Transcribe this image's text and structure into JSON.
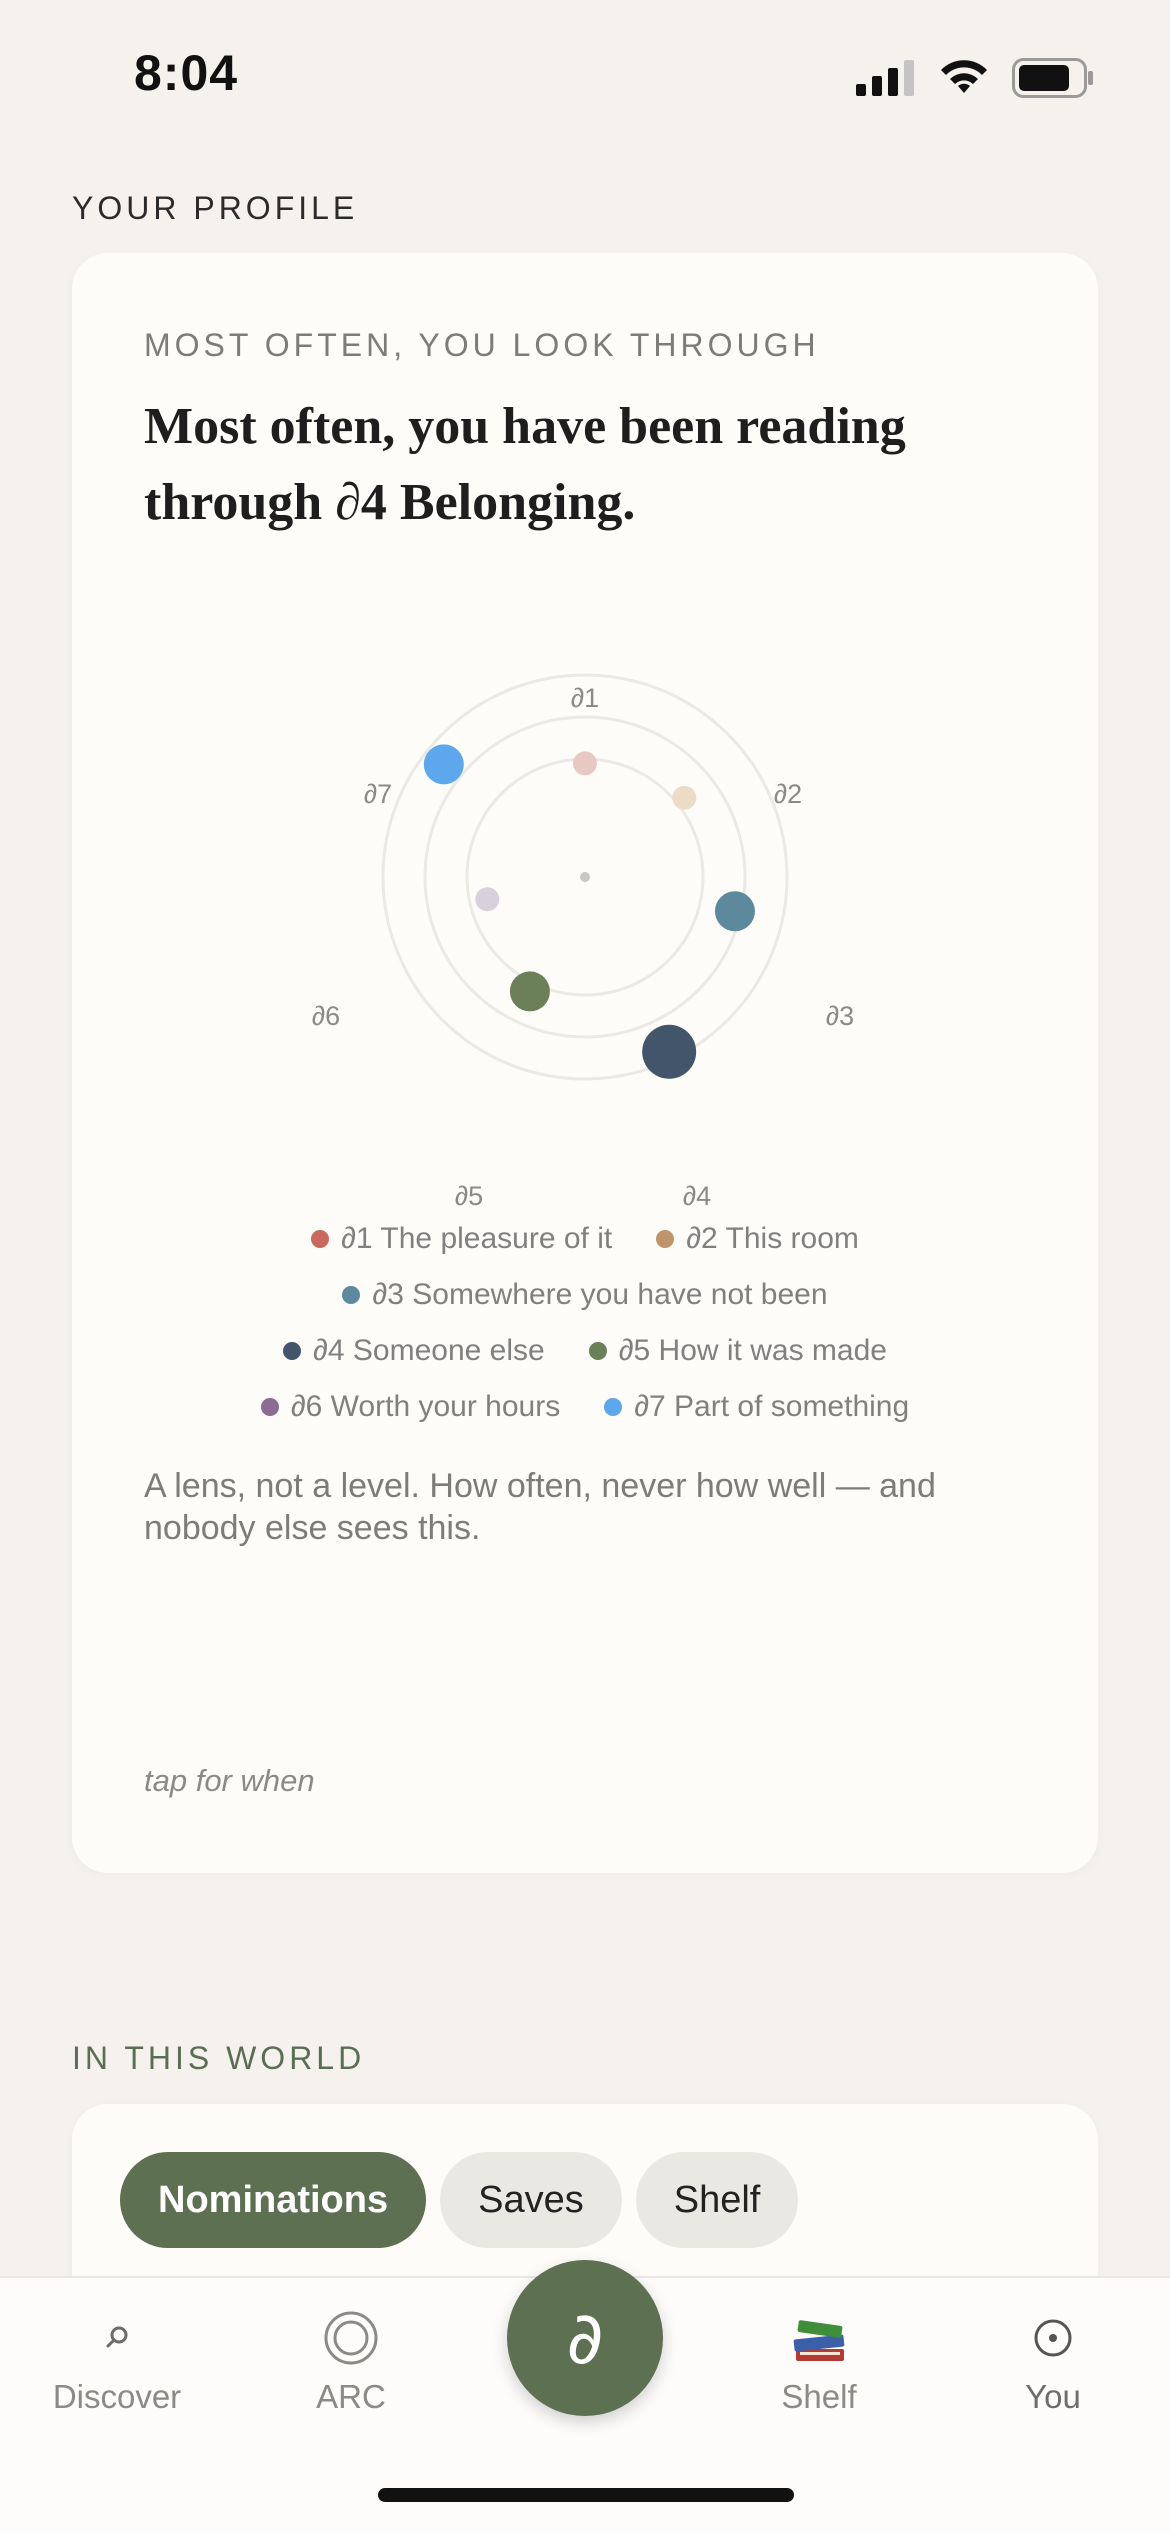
{
  "status_bar": {
    "time": "8:04"
  },
  "profile": {
    "section_label": "YOUR PROFILE",
    "kicker": "MOST OFTEN, YOU LOOK THROUGH",
    "headline": "Most often, you have been reading through ∂4 Belonging.",
    "radar": {
      "axis_labels": [
        "∂1",
        "∂2",
        "∂3",
        "∂4",
        "∂5",
        "∂6",
        "∂7"
      ],
      "points": [
        {
          "lens": "∂1",
          "color": "#e8c9c2",
          "level": 0.4,
          "size": "small"
        },
        {
          "lens": "∂2",
          "color": "#ecdcc6",
          "level": 0.5,
          "size": "small"
        },
        {
          "lens": "∂3",
          "color": "#5c8a9c",
          "level": 0.7,
          "size": "medium"
        },
        {
          "lens": "∂4",
          "color": "#42556b",
          "level": 1.0,
          "size": "large"
        },
        {
          "lens": "∂5",
          "color": "#6b7f58",
          "level": 0.5,
          "size": "medium"
        },
        {
          "lens": "∂6",
          "color": "#d8d0dc",
          "level": 0.3,
          "size": "small"
        },
        {
          "lens": "∂7",
          "color": "#5da8ec",
          "level": 0.9,
          "size": "medium"
        }
      ]
    },
    "legend": [
      [
        {
          "label": "∂1 The pleasure of it",
          "color": "#c9685c"
        },
        {
          "label": "∂2 This room",
          "color": "#bf946a"
        }
      ],
      [
        {
          "label": "∂3 Somewhere you have not been",
          "color": "#5c8a9c"
        }
      ],
      [
        {
          "label": "∂4 Someone else",
          "color": "#42556b"
        },
        {
          "label": "∂5 How it was made",
          "color": "#6b7f58"
        }
      ],
      [
        {
          "label": "∂6 Worth your hours",
          "color": "#8a6c94"
        },
        {
          "label": "∂7 Part of something",
          "color": "#5da8ec"
        }
      ]
    ],
    "note": "A lens, not a level. How often, never how well — and nobody else sees this.",
    "tap_hint": "tap for when"
  },
  "world": {
    "section_label": "IN THIS WORLD",
    "pills": [
      {
        "label": "Nominations",
        "active": true
      },
      {
        "label": "Saves",
        "active": false
      },
      {
        "label": "Shelf",
        "active": false
      }
    ]
  },
  "tabbar": {
    "discover": "Discover",
    "arc": "ARC",
    "center_glyph": "∂",
    "shelf": "Shelf",
    "you": "You"
  }
}
